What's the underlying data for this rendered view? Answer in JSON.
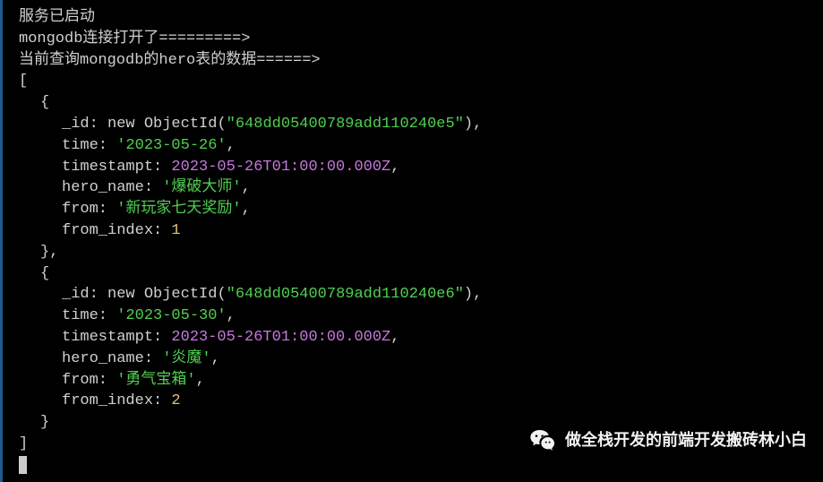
{
  "log": {
    "line1": "服务已启动",
    "line2_prefix": "mongodb",
    "line2_rest": "连接打开了=========>",
    "line3_prefix": "当前查询mongodb的hero表的数据",
    "line3_rest": "======>",
    "bracket_open": "[",
    "brace_open": "{",
    "brace_close_comma": "},",
    "brace_close": "}",
    "bracket_close": "]"
  },
  "records": [
    {
      "id_key": "_id:",
      "id_new": " new",
      "id_fn": " ObjectId(",
      "id_val": "\"648dd05400789add110240e5\"",
      "id_close": "),",
      "time_key": "time:",
      "time_val": " '2023-05-26'",
      "time_comma": ",",
      "ts_key": "timestampt:",
      "ts_val": " 2023-05-26T01:00:00.000Z",
      "ts_comma": ",",
      "hero_key": "hero_name:",
      "hero_val": " '爆破大师'",
      "hero_comma": ",",
      "from_key": "from:",
      "from_val": " '新玩家七天奖励'",
      "from_comma": ",",
      "fi_key": "from_index:",
      "fi_val": " 1"
    },
    {
      "id_key": "_id:",
      "id_new": " new",
      "id_fn": " ObjectId(",
      "id_val": "\"648dd05400789add110240e6\"",
      "id_close": "),",
      "time_key": "time:",
      "time_val": " '2023-05-30'",
      "time_comma": ",",
      "ts_key": "timestampt:",
      "ts_val": " 2023-05-26T01:00:00.000Z",
      "ts_comma": ",",
      "hero_key": "hero_name:",
      "hero_val": " '炎魔'",
      "hero_comma": ",",
      "from_key": "from:",
      "from_val": " '勇气宝箱'",
      "from_comma": ",",
      "fi_key": "from_index:",
      "fi_val": " 2"
    }
  ],
  "watermark": {
    "text": "做全栈开发的前端开发搬砖林小白"
  }
}
